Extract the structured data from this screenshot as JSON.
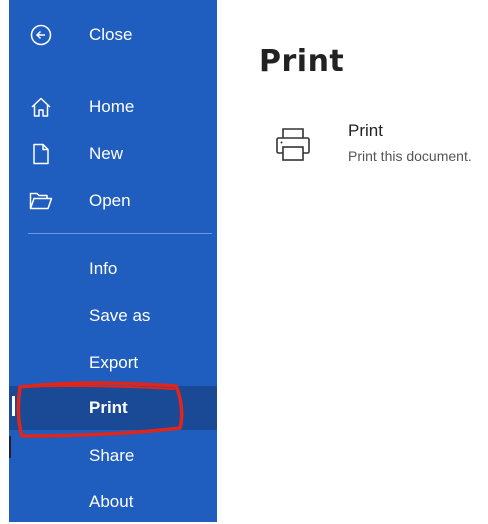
{
  "sidebar": {
    "close_label": "Close",
    "items_top": [
      {
        "label": "Home",
        "icon": "home-icon"
      },
      {
        "label": "New",
        "icon": "new-document-icon"
      },
      {
        "label": "Open",
        "icon": "folder-open-icon"
      }
    ],
    "items_bottom": [
      {
        "label": "Info"
      },
      {
        "label": "Save as"
      },
      {
        "label": "Export"
      },
      {
        "label": "Print",
        "selected": true
      },
      {
        "label": "Share"
      },
      {
        "label": "About"
      }
    ]
  },
  "main": {
    "title": "Print",
    "option": {
      "title": "Print",
      "description": "Print this document.",
      "icon": "printer-icon"
    }
  },
  "colors": {
    "sidebar_bg": "#1f5ebf",
    "selected_bg": "#1a4a96",
    "annotation": "#e0251b"
  }
}
